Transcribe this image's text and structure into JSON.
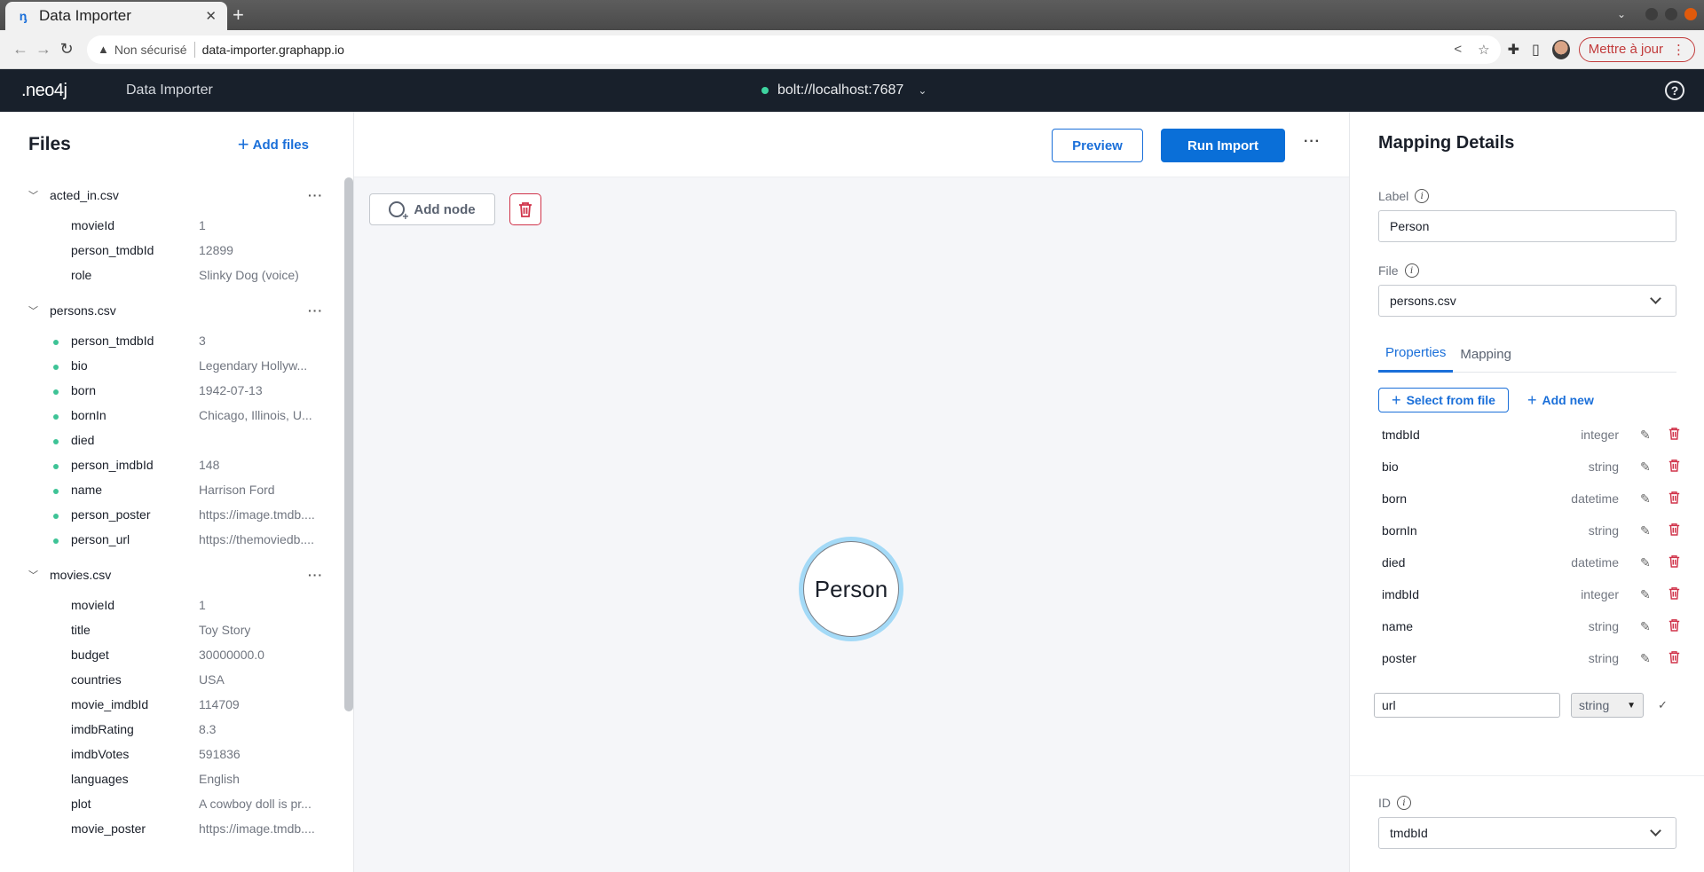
{
  "browser": {
    "tab_title": "Data Importer",
    "security_label": "Non sécurisé",
    "url": "data-importer.graphapp.io",
    "update_button": "Mettre à jour"
  },
  "header": {
    "logo": ".neo4j",
    "app_title": "Data Importer",
    "connection": "bolt://localhost:7687",
    "connection_status_color": "#3ed4a0"
  },
  "files_panel": {
    "title": "Files",
    "add_files_label": "Add files",
    "files": [
      {
        "name": "acted_in.csv",
        "mapped": false,
        "columns": [
          {
            "name": "movieId",
            "sample": "1"
          },
          {
            "name": "person_tmdbId",
            "sample": "12899"
          },
          {
            "name": "role",
            "sample": "Slinky Dog (voice)"
          }
        ]
      },
      {
        "name": "persons.csv",
        "mapped": true,
        "columns": [
          {
            "name": "person_tmdbId",
            "sample": "3"
          },
          {
            "name": "bio",
            "sample": "Legendary Hollyw..."
          },
          {
            "name": "born",
            "sample": "1942-07-13"
          },
          {
            "name": "bornIn",
            "sample": "Chicago, Illinois, U..."
          },
          {
            "name": "died",
            "sample": ""
          },
          {
            "name": "person_imdbId",
            "sample": "148"
          },
          {
            "name": "name",
            "sample": "Harrison Ford"
          },
          {
            "name": "person_poster",
            "sample": "https://image.tmdb...."
          },
          {
            "name": "person_url",
            "sample": "https://themoviedb...."
          }
        ]
      },
      {
        "name": "movies.csv",
        "mapped": false,
        "columns": [
          {
            "name": "movieId",
            "sample": "1"
          },
          {
            "name": "title",
            "sample": "Toy Story"
          },
          {
            "name": "budget",
            "sample": "30000000.0"
          },
          {
            "name": "countries",
            "sample": "USA"
          },
          {
            "name": "movie_imdbId",
            "sample": "114709"
          },
          {
            "name": "imdbRating",
            "sample": "8.3"
          },
          {
            "name": "imdbVotes",
            "sample": "591836"
          },
          {
            "name": "languages",
            "sample": "English"
          },
          {
            "name": "plot",
            "sample": "A cowboy doll is pr..."
          },
          {
            "name": "movie_poster",
            "sample": "https://image.tmdb...."
          }
        ]
      }
    ]
  },
  "toolbar": {
    "preview_label": "Preview",
    "run_import_label": "Run Import",
    "add_node_label": "Add node"
  },
  "canvas": {
    "nodes": [
      {
        "label": "Person",
        "selected": true
      }
    ]
  },
  "mapping_details": {
    "title": "Mapping Details",
    "label_field": {
      "label": "Label",
      "value": "Person"
    },
    "file_field": {
      "label": "File",
      "value": "persons.csv"
    },
    "tabs": [
      {
        "label": "Properties",
        "active": true
      },
      {
        "label": "Mapping",
        "active": false
      }
    ],
    "select_from_file_label": "Select from file",
    "add_new_label": "Add new",
    "properties": [
      {
        "name": "tmdbId",
        "type": "integer"
      },
      {
        "name": "bio",
        "type": "string"
      },
      {
        "name": "born",
        "type": "datetime"
      },
      {
        "name": "bornIn",
        "type": "string"
      },
      {
        "name": "died",
        "type": "datetime"
      },
      {
        "name": "imdbId",
        "type": "integer"
      },
      {
        "name": "name",
        "type": "string"
      },
      {
        "name": "poster",
        "type": "string"
      }
    ],
    "editing_property": {
      "name": "url",
      "type": "string"
    },
    "id_field": {
      "label": "ID",
      "value": "tmdbId"
    }
  }
}
